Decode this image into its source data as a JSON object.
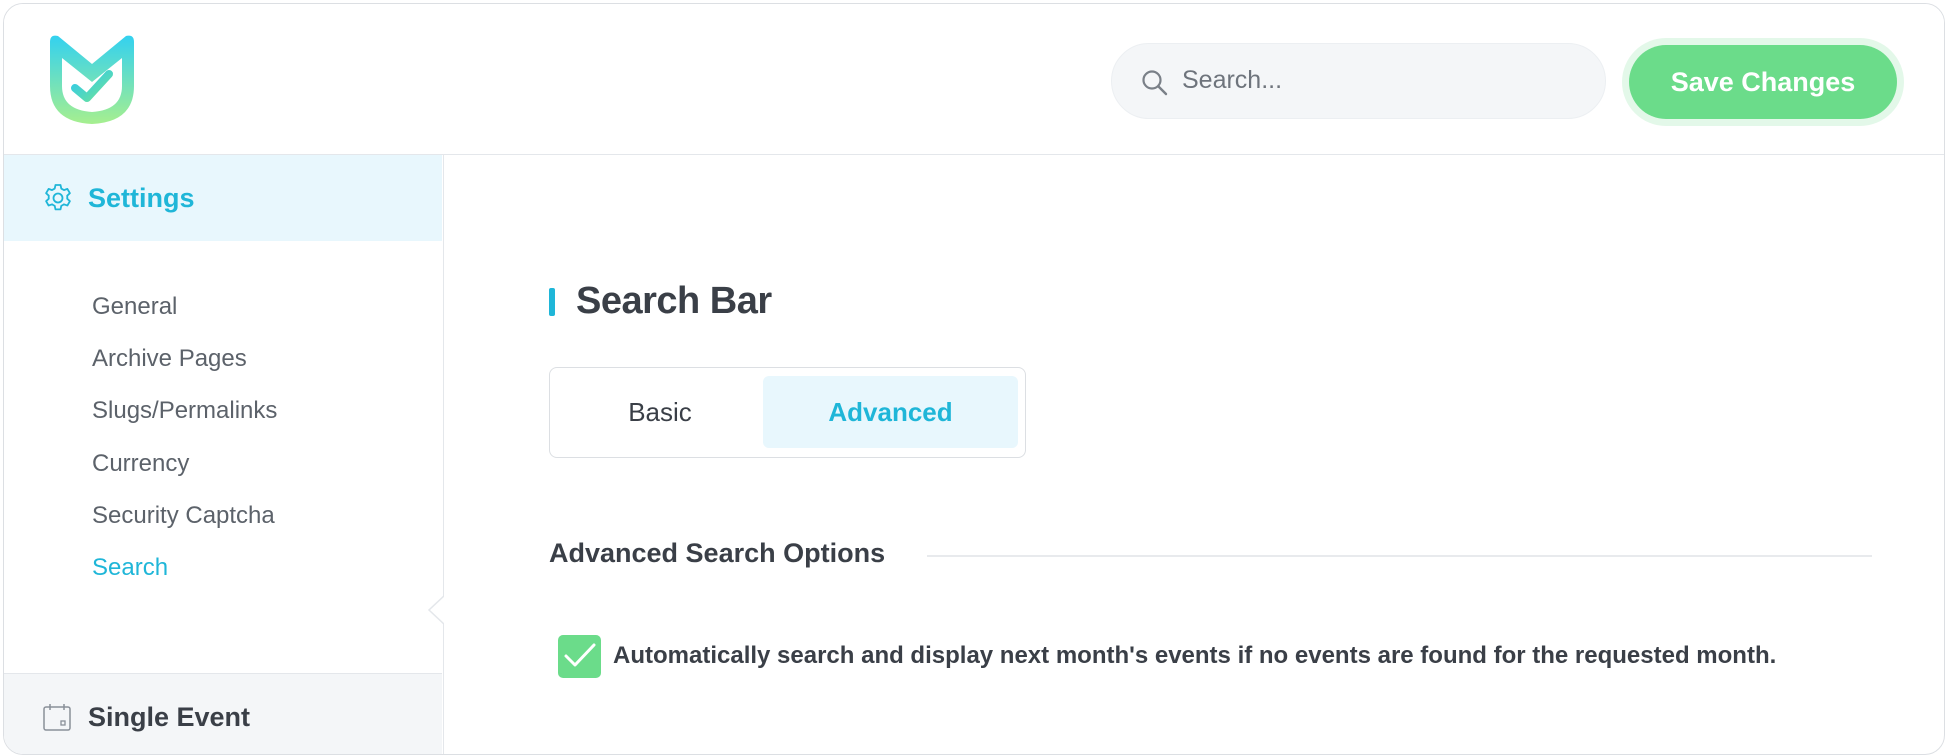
{
  "header": {
    "logo_icon": "calendar-check-logo-icon",
    "search": {
      "placeholder": "Search...",
      "value": "",
      "icon": "search-icon"
    },
    "save_label": "Save Changes"
  },
  "colors": {
    "accent": "#1fb6d8",
    "success": "#6bdc8a",
    "active_bg": "#e8f7fd"
  },
  "sidebar": {
    "settings": {
      "label": "Settings",
      "icon": "gear-icon"
    },
    "items": [
      {
        "label": "General",
        "active": false
      },
      {
        "label": "Archive Pages",
        "active": false
      },
      {
        "label": "Slugs/Permalinks",
        "active": false
      },
      {
        "label": "Currency",
        "active": false
      },
      {
        "label": "Security Captcha",
        "active": false
      },
      {
        "label": "Search",
        "active": true
      }
    ],
    "single_event": {
      "label": "Single Event",
      "icon": "calendar-icon"
    }
  },
  "main": {
    "title": "Search Bar",
    "tabs": [
      {
        "label": "Basic",
        "active": false
      },
      {
        "label": "Advanced",
        "active": true
      }
    ],
    "section_title": "Advanced Search Options",
    "options": [
      {
        "label": "Automatically search and display next month's events if no events are found for the requested month.",
        "checked": true
      }
    ]
  }
}
